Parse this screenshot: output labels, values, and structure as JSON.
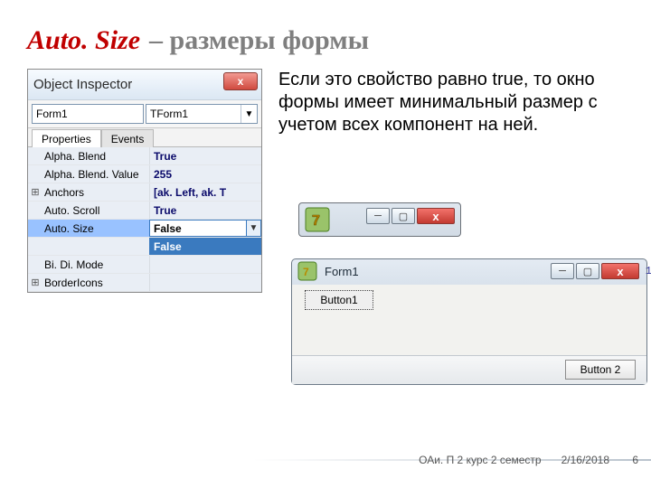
{
  "title": {
    "auto": "Auto. Size",
    "rest": "– размеры формы"
  },
  "paragraph": "Если это свойство равно true, то окно формы имеет минимальный размер с учетом всех компонент на ней.",
  "inspector": {
    "title": "Object Inspector",
    "object_name": "Form1",
    "object_class": "TForm1",
    "tabs": {
      "properties": "Properties",
      "events": "Events"
    },
    "rows": [
      {
        "exp": "",
        "name": "Alpha. Blend",
        "val": "True"
      },
      {
        "exp": "",
        "name": "Alpha. Blend. Value",
        "val": "255"
      },
      {
        "exp": "⊞",
        "name": "Anchors",
        "val": "[ak. Left, ak. T"
      },
      {
        "exp": "",
        "name": "Auto. Scroll",
        "val": "True"
      }
    ],
    "autosize": {
      "name": "Auto. Size",
      "val": "False",
      "dropdown": "False"
    },
    "after": [
      {
        "exp": "",
        "name": "Bi. Di. Mode",
        "val": ""
      },
      {
        "exp": "⊞",
        "name": "BorderIcons",
        "val": ""
      }
    ]
  },
  "small_window": {
    "icon_label": "7"
  },
  "form": {
    "title": "Form1",
    "button1": "Button1",
    "button2": "Button 2",
    "side_marker": "1"
  },
  "footer": {
    "course": "ОАи. П 2 курс 2 семестр",
    "date": "2/16/2018",
    "page": "6"
  }
}
